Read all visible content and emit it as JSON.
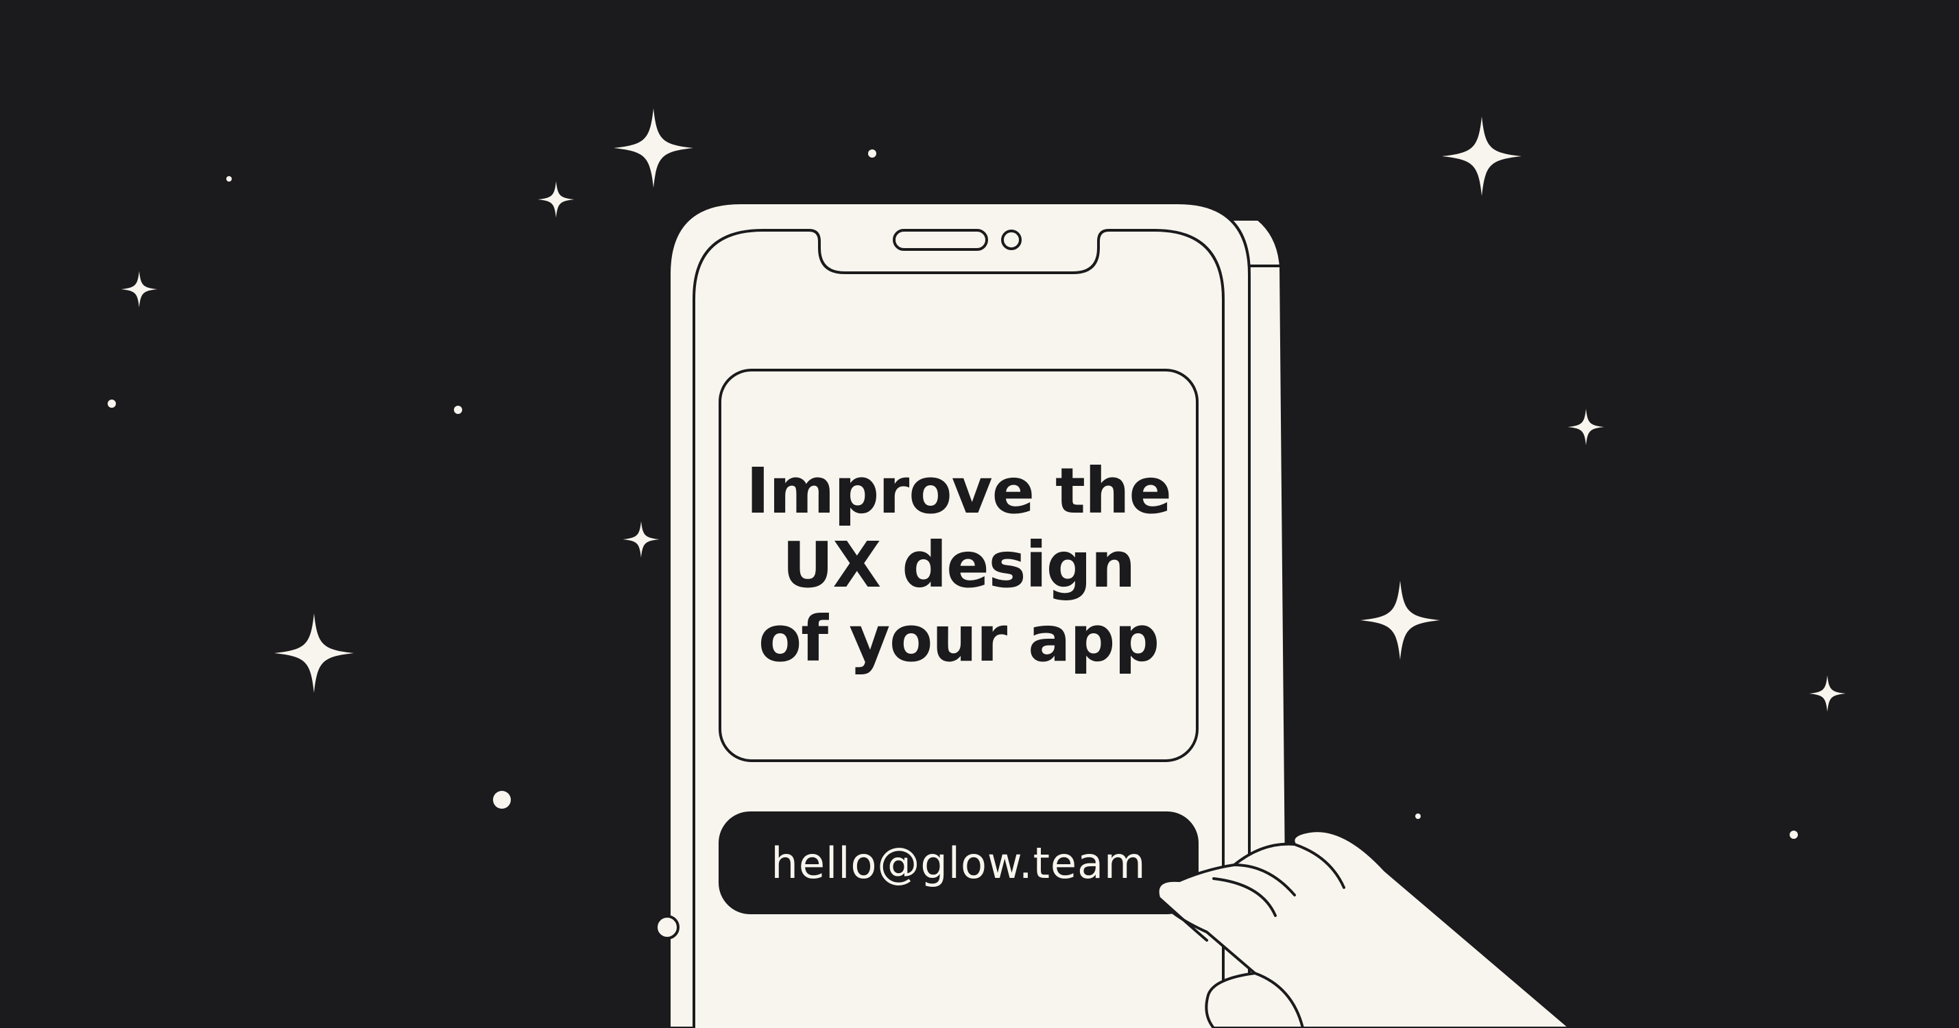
{
  "card": {
    "headline": [
      "Improve the",
      "UX design",
      "of your app"
    ],
    "email": "hello@glow.team"
  },
  "colors": {
    "background": "#1b1b1d",
    "cream": "#f8f5ee",
    "ink": "#1b1b1d"
  },
  "icons": [
    "sparkle-star-icon",
    "dot-star-icon",
    "phone-illustration",
    "hand-illustration"
  ]
}
